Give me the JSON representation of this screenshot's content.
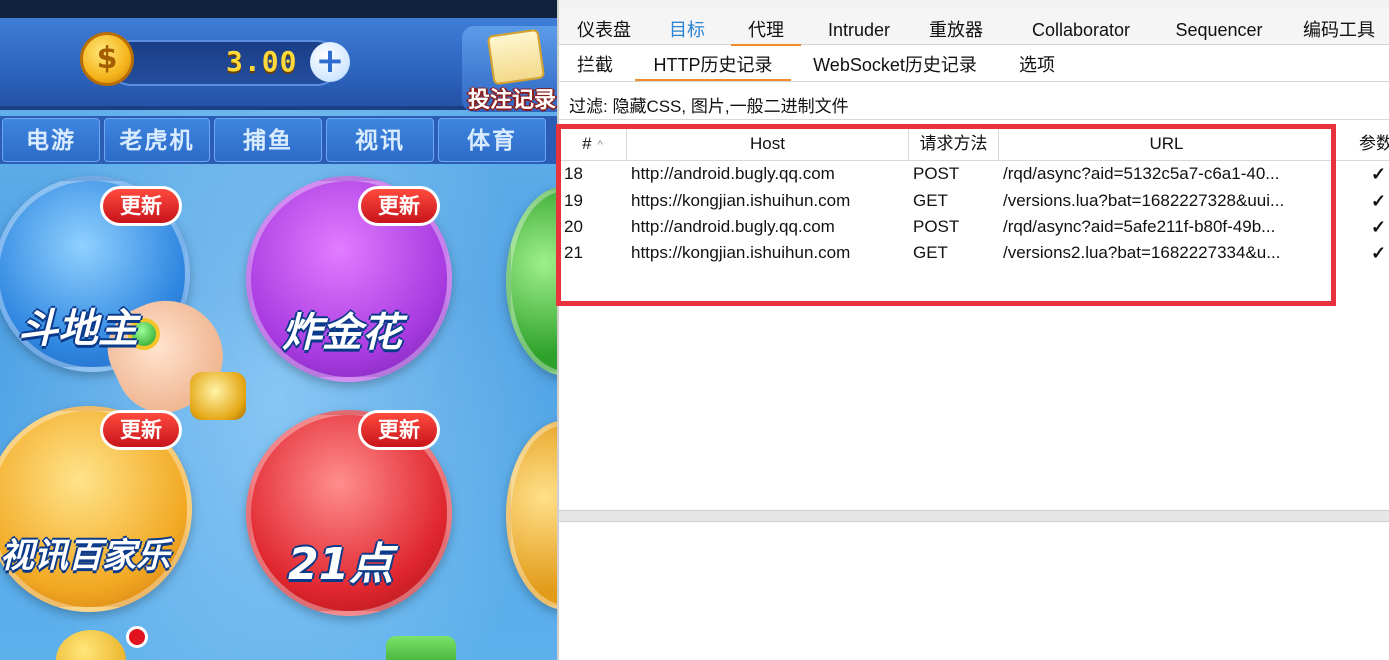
{
  "game": {
    "balance": "3.00",
    "coin_symbol": "$",
    "plus_symbol": "+",
    "bet_record_label": "投注记录",
    "categories": [
      "电游",
      "老虎机",
      "捕鱼",
      "视讯",
      "体育"
    ],
    "games": [
      {
        "name": "斗地主",
        "badge": "更新"
      },
      {
        "name": "炸金花",
        "badge": "更新"
      },
      {
        "name": "视讯百家乐",
        "badge": "更新"
      },
      {
        "name": "21点",
        "badge": "更新"
      }
    ]
  },
  "burp": {
    "main_tabs": [
      "仪表盘",
      "目标",
      "代理",
      "Intruder",
      "重放器",
      "Collaborator",
      "Sequencer",
      "编码工具"
    ],
    "sub_tabs": [
      "拦截",
      "HTTP历史记录",
      "WebSocket历史记录",
      "选项"
    ],
    "filter": "过滤: 隐藏CSS, 图片,一般二进制文件",
    "columns": [
      "#",
      "Host",
      "请求方法",
      "URL",
      "参数"
    ],
    "sort_indicator": "^",
    "rows": [
      {
        "id": "18",
        "host": "http://android.bugly.qq.com",
        "method": "POST",
        "url": "/rqd/async?aid=5132c5a7-c6a1-40...",
        "params": "✓"
      },
      {
        "id": "19",
        "host": "https://kongjian.ishuihun.com",
        "method": "GET",
        "url": "/versions.lua?bat=1682227328&uui...",
        "params": "✓"
      },
      {
        "id": "20",
        "host": "http://android.bugly.qq.com",
        "method": "POST",
        "url": "/rqd/async?aid=5afe211f-b80f-49b...",
        "params": "✓"
      },
      {
        "id": "21",
        "host": "https://kongjian.ishuihun.com",
        "method": "GET",
        "url": "/versions2.lua?bat=1682227334&u...",
        "params": "✓"
      }
    ],
    "colors": {
      "active_tab_underline": "#f08a2c",
      "target_tab_text": "#2b83d4",
      "highlight_box": "#e8323d"
    }
  }
}
